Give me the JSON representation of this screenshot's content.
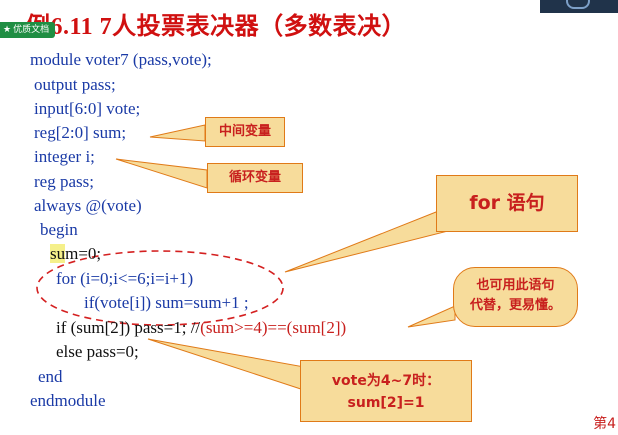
{
  "title": "例6.11  7人投票表决器（多数表决）",
  "badge": "优质文档",
  "code": {
    "l1": "module voter7 (pass,vote);",
    "l2": "output  pass;",
    "l3": "input[6:0] vote;",
    "l4": "reg[2:0] sum;",
    "l5": "integer i;",
    "l6": "reg pass;",
    "l7": "always @(vote)",
    "l8": "begin",
    "l9a": "su",
    "l9b": "m=0;",
    "l10": "for (i=0;i<=6;i=i+1)",
    "l11": "if(vote[i])  sum=sum+1 ;",
    "l12a": "if (sum[2])  pass=1; //",
    "l12b": "(sum>=4)==(sum[2])",
    "l13": "else pass=0;",
    "l14": "end",
    "l15": "endmodule"
  },
  "callouts": {
    "mid_var": "中间变量",
    "loop_var": "循环变量",
    "for_stmt": "for 语句",
    "alt_line1": "也可用此语句",
    "alt_line2": "代替，更易懂。",
    "vote_line1": "vote为4~7时：",
    "vote_line2": "sum[2]=1"
  },
  "page_number": "第4",
  "colors": {
    "code": "#1a3aa6",
    "title": "#c8201e",
    "callout_fill": "#f7dc9b",
    "callout_border": "#e07a18"
  }
}
